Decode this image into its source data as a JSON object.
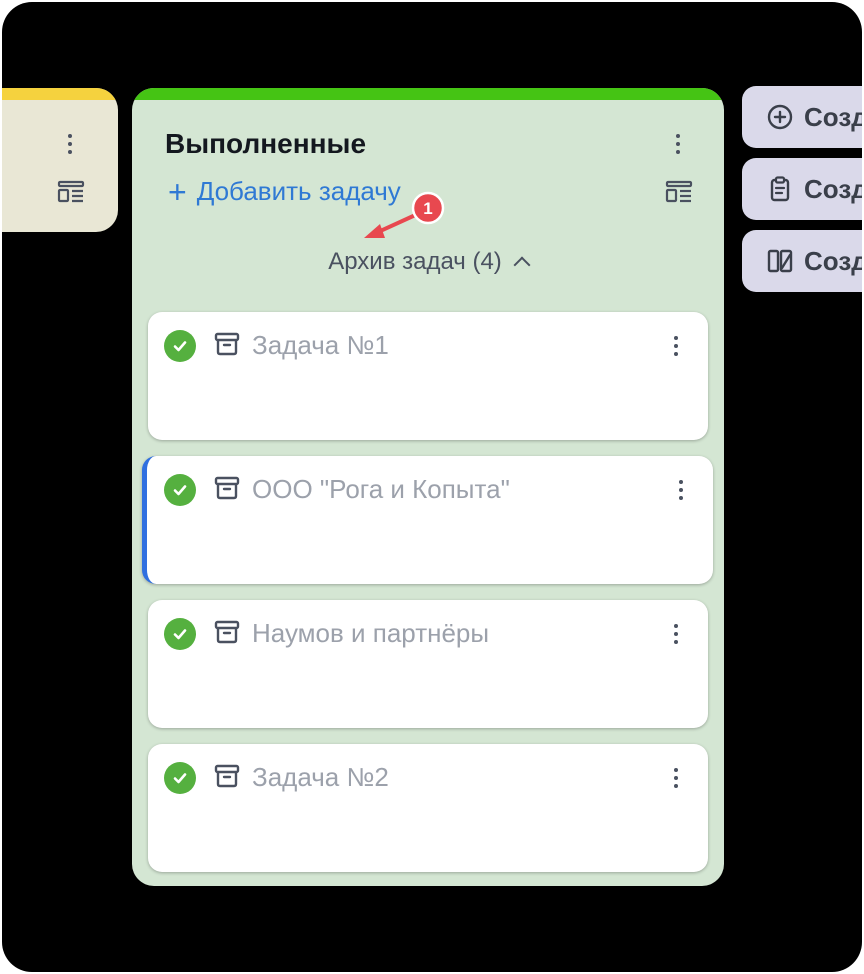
{
  "left_column": {
    "accent_color": "#f5d23e"
  },
  "column": {
    "title": "Выполненные",
    "accent_color": "#45c414",
    "add_task_label": "Добавить задачу",
    "archive_label": "Архив задач (4)",
    "cards": [
      {
        "title": "Задача №1",
        "active": false
      },
      {
        "title": "ООО \"Рога и Копыта\"",
        "active": true
      },
      {
        "title": "Наумов и партнёры",
        "active": false
      },
      {
        "title": "Задача №2",
        "active": false
      }
    ]
  },
  "annotation": {
    "badge": "1"
  },
  "right_buttons": [
    {
      "label": "Созд",
      "icon": "plus-circle-icon"
    },
    {
      "label": "Созд",
      "icon": "clipboard-icon"
    },
    {
      "label": "Созд",
      "icon": "columns-edit-icon"
    }
  ]
}
